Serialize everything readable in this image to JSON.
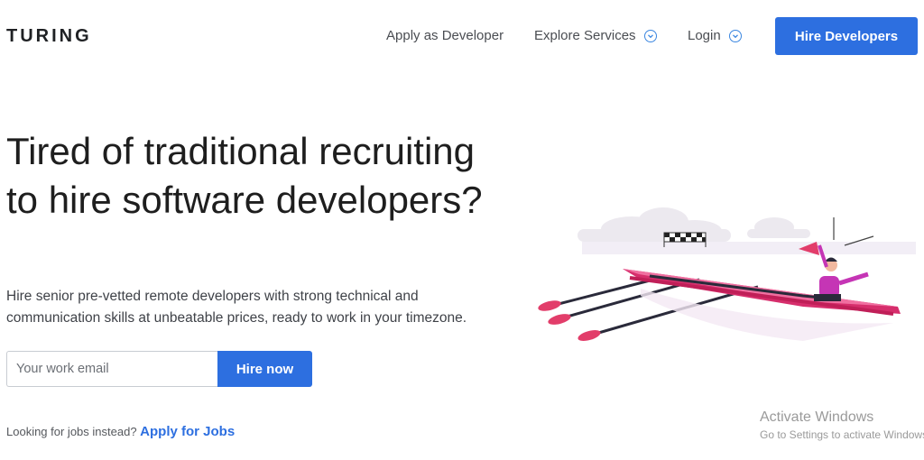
{
  "header": {
    "logo": "TURING",
    "nav": {
      "apply_developer": "Apply as Developer",
      "explore_services": "Explore Services",
      "login": "Login"
    },
    "hire_developers_button": "Hire Developers"
  },
  "hero": {
    "headline": "Tired of traditional recruiting to hire software developers?",
    "subtext": "Hire senior pre-vetted remote developers with strong technical and communication skills at unbeatable prices, ready to work in your timezone.",
    "email_placeholder": "Your work email",
    "hire_now_button": "Hire now",
    "jobs_prompt": "Looking for jobs instead?",
    "jobs_link": "Apply for Jobs"
  },
  "watermark": {
    "title": "Activate Windows",
    "subtitle": "Go to Settings to activate Windows."
  },
  "colors": {
    "accent": "#2d6fe0",
    "boat": "#e8407a",
    "rower_shirt": "#c535b5"
  },
  "icons": {
    "explore_chevron": "chevron-down-circle-icon",
    "login_chevron": "chevron-down-circle-icon"
  }
}
